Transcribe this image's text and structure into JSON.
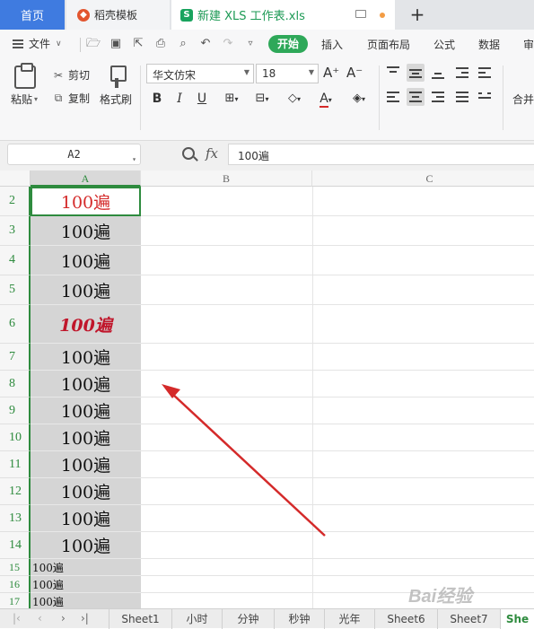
{
  "tabs": {
    "home": "首页",
    "template": "稻壳模板",
    "file": "新建 XLS 工作表.xls",
    "new_tab": "+"
  },
  "menu": {
    "file": "文件",
    "items": [
      "开始",
      "插入",
      "页面布局",
      "公式",
      "数据",
      "审"
    ]
  },
  "ribbon": {
    "paste": "粘贴",
    "cut": "剪切",
    "copy": "复制",
    "format_painter": "格式刷",
    "font_name": "华文仿宋",
    "font_size": "18",
    "bold": "B",
    "italic": "I",
    "underline": "U",
    "grow": "A⁺",
    "shrink": "A⁻",
    "font_color_label": "A",
    "merge_label": "合并"
  },
  "formula_bar": {
    "name_box": "A2",
    "fx": "fx",
    "value": "100遍"
  },
  "columns": [
    "A",
    "B",
    "C"
  ],
  "rows": [
    {
      "num": "2",
      "value": "100遍"
    },
    {
      "num": "3",
      "value": "100遍"
    },
    {
      "num": "4",
      "value": "100遍"
    },
    {
      "num": "5",
      "value": "100遍"
    },
    {
      "num": "6",
      "value": "100遍"
    },
    {
      "num": "7",
      "value": "100遍"
    },
    {
      "num": "8",
      "value": "100遍"
    },
    {
      "num": "9",
      "value": "100遍"
    },
    {
      "num": "10",
      "value": "100遍"
    },
    {
      "num": "11",
      "value": "100遍"
    },
    {
      "num": "12",
      "value": "100遍"
    },
    {
      "num": "13",
      "value": "100遍"
    },
    {
      "num": "14",
      "value": "100遍"
    },
    {
      "num": "15",
      "value": "100遍"
    },
    {
      "num": "16",
      "value": "100遍"
    },
    {
      "num": "17",
      "value": "100遍"
    }
  ],
  "sheet_tabs": [
    "Sheet1",
    "小时",
    "分钟",
    "秒钟",
    "光年",
    "Sheet6",
    "Sheet7",
    "She"
  ],
  "watermark": "Bai经验",
  "colors": {
    "accent_green": "#2e8b3e",
    "home_tab": "#3f7be0",
    "arrow": "#d42a2a"
  }
}
